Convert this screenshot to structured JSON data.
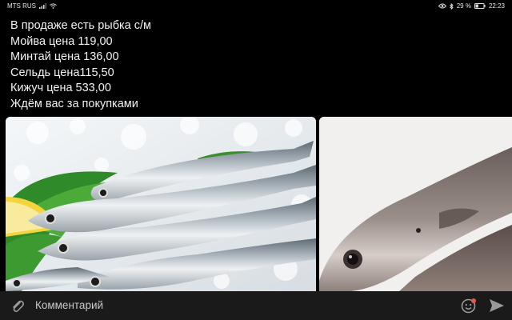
{
  "status_bar": {
    "carrier": "MTS RUS",
    "battery_percent": "29 %",
    "time": "22:23"
  },
  "post": {
    "lines": [
      "В продаже есть рыбка с/м",
      "Мойва цена 119,00",
      "Минтай цена 136,00",
      "Сельдь цена115,50",
      "Кижуч цена 533,00",
      "Ждём вас за покупками"
    ],
    "photos": [
      {
        "icon": "capelin-fish-photo"
      },
      {
        "icon": "pollock-fish-photo"
      }
    ]
  },
  "comment_bar": {
    "placeholder": "Комментарий",
    "attach_icon": "paperclip-icon",
    "emoji_icon": "emoji-icon",
    "send_icon": "send-icon",
    "accent_color": "#8a8a8a"
  }
}
